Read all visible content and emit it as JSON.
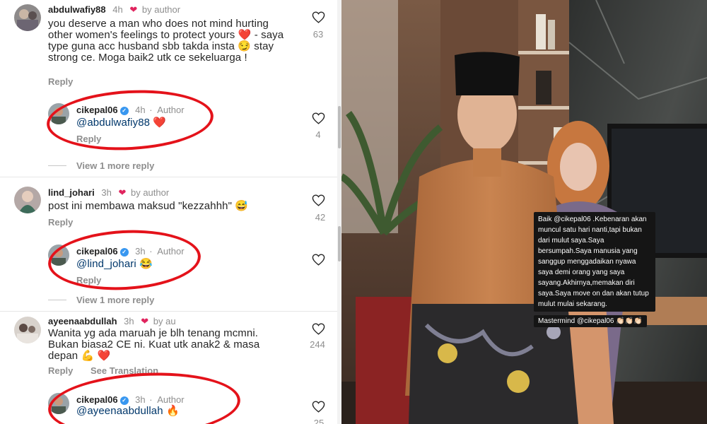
{
  "comments": [
    {
      "username": "abdulwafiy88",
      "time": "4h",
      "by_author": "by author",
      "text": "you deserve a man who does not mind hurting other women's feelings to protect yours",
      "text2": " - saya type guna acc husband sbb takda insta",
      "text3": " stay strong ce. Moga baik2 utk ce sekeluarga !",
      "likes": "63",
      "reply_label": "Reply",
      "reply": {
        "username": "cikepal06",
        "time": "4h",
        "role": "Author",
        "mention": "@abdulwafiy88",
        "likes": "4",
        "reply_label": "Reply"
      },
      "view_more": "View 1 more reply"
    },
    {
      "username": "lind_johari",
      "time": "3h",
      "by_author": "by author",
      "text": "post ini membawa maksud \"kezzahhh\"",
      "likes": "42",
      "reply_label": "Reply",
      "reply": {
        "username": "cikepal06",
        "time": "3h",
        "role": "Author",
        "mention": "@lind_johari",
        "reply_label": "Reply"
      },
      "view_more": "View 1 more reply"
    },
    {
      "username": "ayeenaabdullah",
      "time": "3h",
      "by_author": "by au",
      "text": "Wanita yg ada maruah je blh tenang mcmni. Bukan biasa2 CE ni. Kuat utk anak2 & masa depan",
      "likes": "244",
      "reply_label": "Reply",
      "see_translation": "See Translation",
      "reply": {
        "username": "cikepal06",
        "time": "3h",
        "role": "Author",
        "mention": "@ayeenaabdullah",
        "likes": "25"
      }
    }
  ],
  "story_overlay": {
    "text": "Baik @cikepal06 .Kebenaran akan muncul satu hari nanti,tapi bukan dari mulut saya.Saya bersumpah.Saya manusia yang sanggup menggadaikan nyawa saya demi orang yang saya sayang.Akhirnya,memakan diri saya.Saya move on dan akan tutup mulut mulai sekarang.",
    "credit": "Mastermind @cikepal06 👏🏻👏🏻👏🏻"
  },
  "colors": {
    "highlight_ring": "#e4121a",
    "like_heart": "#e0245e",
    "mention": "#00376b",
    "verified": "#3897f0"
  },
  "icons": [
    "heart-outline-icon",
    "red-heart-emoji",
    "verified-badge-icon"
  ]
}
